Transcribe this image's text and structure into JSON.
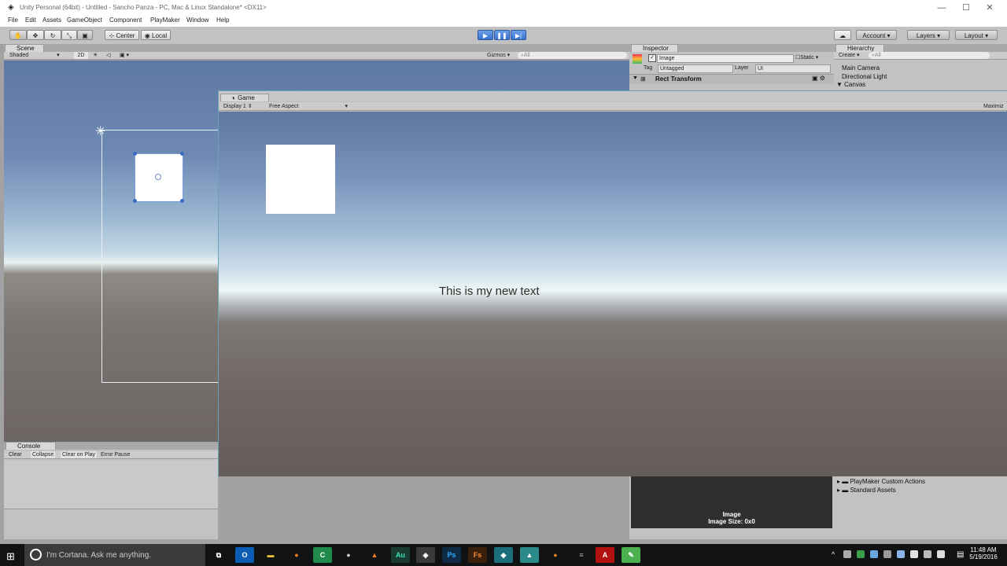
{
  "window": {
    "title": "Unity Personal (64bit) - Untitled - Sancho Panza - PC, Mac & Linux Standalone* <DX11>",
    "controls": {
      "minimize": "—",
      "maximize": "☐",
      "close": "✕"
    }
  },
  "menu": [
    "File",
    "Edit",
    "Assets",
    "GameObject",
    "Component",
    "PlayMaker",
    "Window",
    "Help"
  ],
  "toolbar": {
    "pivot_label": "Center",
    "space_label": "Local",
    "account_label": "Account",
    "layers_label": "Layers",
    "layout_label": "Layout"
  },
  "scene": {
    "tab_label": "Scene",
    "shading_mode": "Shaded",
    "mode_2d": "2D",
    "gizmos_label": "Gizmos",
    "search_placeholder": "All"
  },
  "game": {
    "tab_label": "Game",
    "display": "Display 1",
    "aspect": "Free Aspect",
    "maximize_label": "Maximiz",
    "ui_text": "This is my new text"
  },
  "inspector": {
    "tab_label": "Inspector",
    "object_name": "Image",
    "static_label": "Static",
    "tag_label": "Tag",
    "tag_value": "Untagged",
    "layer_label": "Layer",
    "layer_value": "UI",
    "component_title": "Rect Transform",
    "preview_title": "Image",
    "preview_size": "Image Size: 0x0"
  },
  "hierarchy": {
    "tab_label": "Hierarchy",
    "create_label": "Create",
    "search_placeholder": "All",
    "items": [
      "Main Camera",
      "Directional Light",
      "Canvas"
    ]
  },
  "project": {
    "folders": [
      "PlayMaker Custom Actions",
      "Standard Assets"
    ]
  },
  "console": {
    "tab_label": "Console",
    "buttons": [
      "Clear",
      "Collapse",
      "Clear on Play",
      "Error Pause"
    ]
  },
  "taskbar": {
    "search_placeholder": "I'm Cortana. Ask me anything.",
    "time": "11:48 AM",
    "date": "5/19/2016",
    "apps": [
      "Ps",
      "Fs",
      "Au"
    ]
  }
}
